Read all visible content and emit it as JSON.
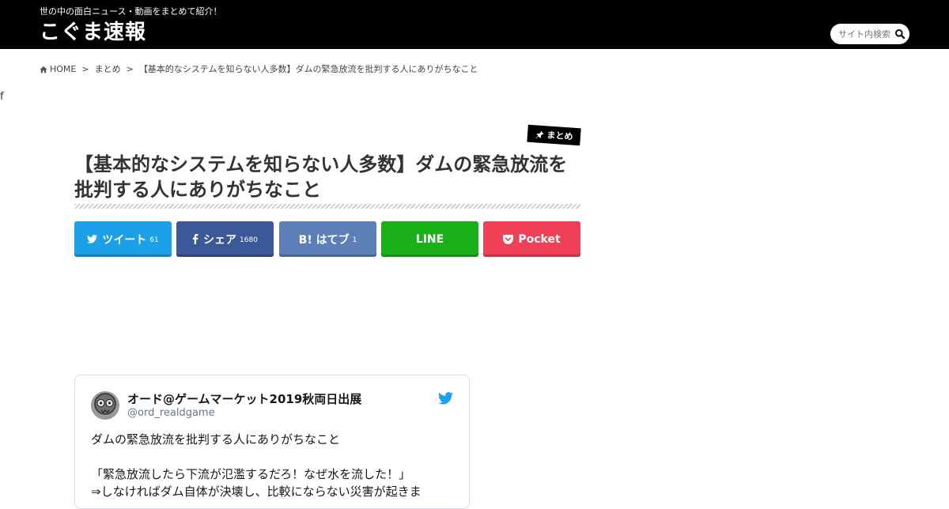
{
  "header": {
    "tagline": "世の中の面白ニュース・動画をまとめて紹介！",
    "logo": "こぐま速報",
    "search_placeholder": "サイト内検索",
    "search_icon": "search-icon",
    "background": "#000000"
  },
  "breadcrumb": {
    "home": "HOME",
    "separator": ">",
    "category": "まとめ",
    "current": "【基本的なシステムを知らない人多数】ダムの緊急放流を批判する人にありがちなこと"
  },
  "stray_text": "f",
  "article": {
    "category_badge": "まとめ",
    "title": "【基本的なシステムを知らない人多数】ダムの緊急放流を批判する人にありがちなこと"
  },
  "share": {
    "twitter": {
      "label": "ツイート",
      "count": "61",
      "color": "#1ca0e8"
    },
    "facebook": {
      "label": "シェア",
      "count": "1680",
      "color": "#3b5998"
    },
    "hatena": {
      "label": "B! はてブ",
      "count": "1",
      "color": "#5d7fb8"
    },
    "line": {
      "label": "LINE",
      "color": "#19b01a"
    },
    "pocket": {
      "label": "Pocket",
      "color": "#ee4056"
    }
  },
  "tweet": {
    "name": "オード@ゲームマーケット2019秋両日出展",
    "handle": "@ord_realdgame",
    "lines": [
      "ダムの緊急放流を批判する人にありがちなこと",
      "",
      "「緊急放流したら下流が氾濫するだろ！なぜ水を流した！」",
      "⇒しなければダム自体が決壊し、比較にならない災害が起きま"
    ]
  }
}
